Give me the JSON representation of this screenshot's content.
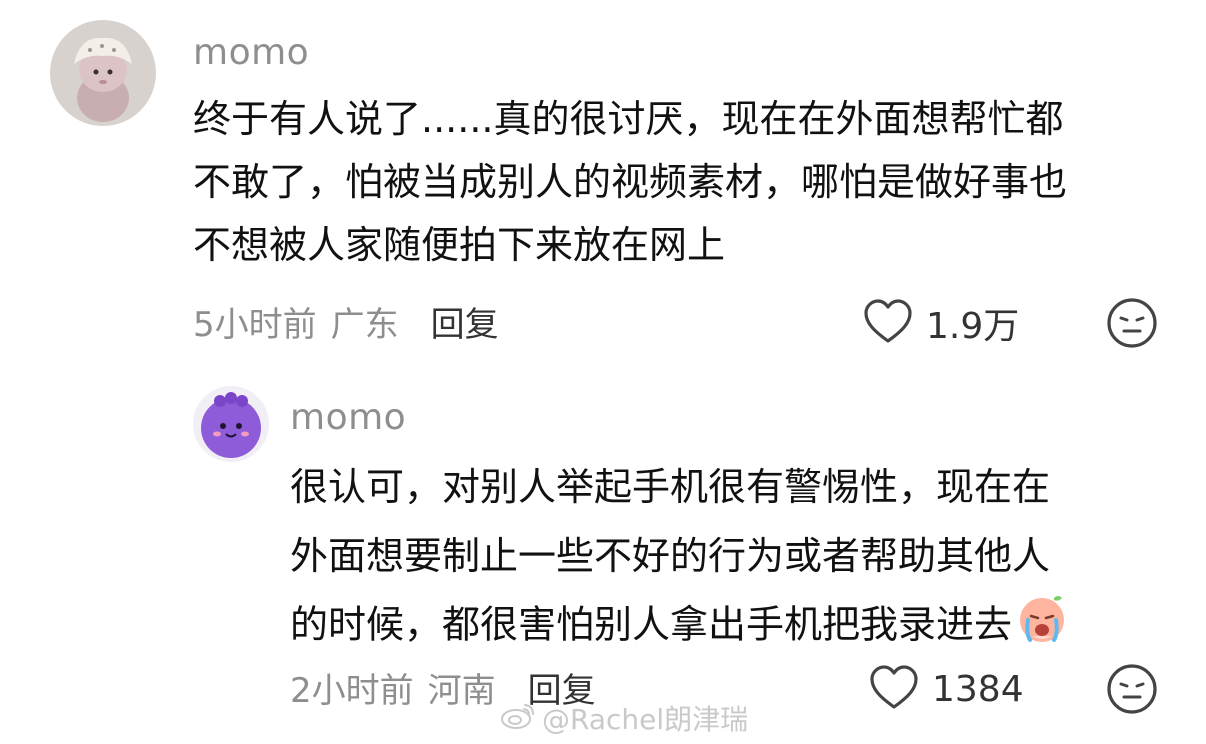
{
  "comments": [
    {
      "username": "momo",
      "lines": [
        "终于有人说了......真的很讨厌，现在在外面想帮忙都",
        "不敢了，怕被当成别人的视频素材，哪怕是做好事也",
        "不想被人家随便拍下来放在网上"
      ],
      "time": "5小时前",
      "location": "广东",
      "reply_label": "回复",
      "likes": "1.9万"
    },
    {
      "username": "momo",
      "lines": [
        "很认可，对别人举起手机很有警惕性，现在在",
        "外面想要制止一些不好的行为或者帮助其他人",
        "的时候，都很害怕别人拿出手机把我录进去"
      ],
      "time": "2小时前",
      "location": "河南",
      "reply_label": "回复",
      "likes": "1384"
    }
  ],
  "watermark": {
    "text": "@Rachel朗津瑞"
  },
  "icons": {
    "like": "heart-outline-icon",
    "dislike": "neutral-face-icon",
    "inline_emoji": "crying-emoji-icon",
    "watermark": "weibo-logo-icon"
  },
  "colors": {
    "username": "#8e8e8e",
    "body_text": "#111111",
    "meta": "#8e8e8e",
    "watermark": "#c9c9c9"
  }
}
